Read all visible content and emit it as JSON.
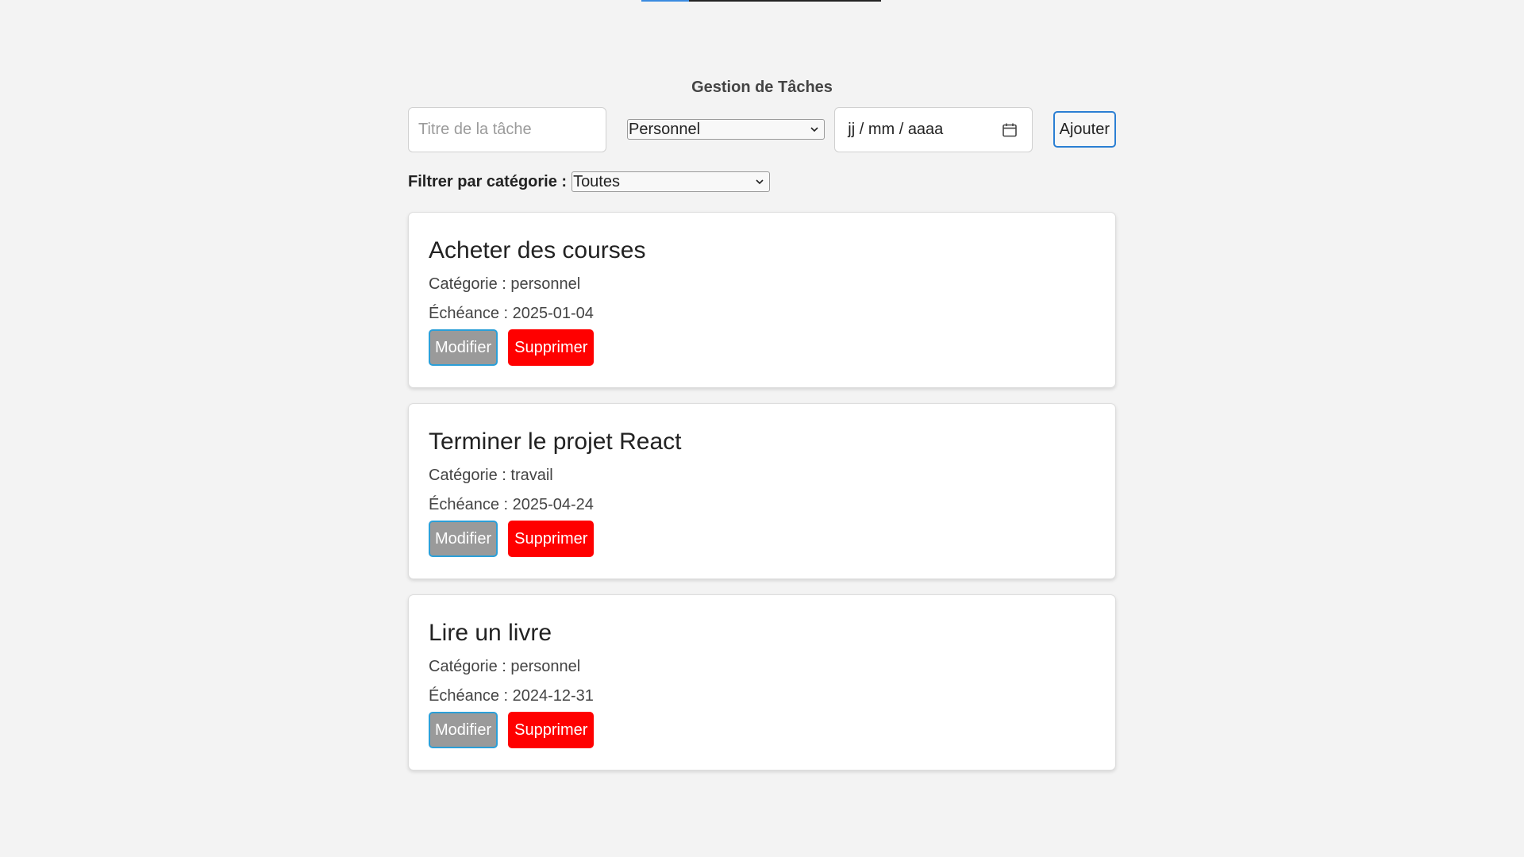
{
  "app": {
    "title": "Gestion de Tâches"
  },
  "form": {
    "title_placeholder": "Titre de la tâche",
    "title_value": "",
    "category_selected": "Personnel",
    "date_placeholder": "jj / mm / aaaa",
    "add_label": "Ajouter"
  },
  "filter": {
    "label": "Filtrer par catégorie :",
    "selected": "Toutes"
  },
  "tasks": [
    {
      "title": "Acheter des courses",
      "category_line": "Catégorie : personnel",
      "due_line": "Échéance : 2025-01-04",
      "edit_label": "Modifier",
      "delete_label": "Supprimer"
    },
    {
      "title": "Terminer le projet React",
      "category_line": "Catégorie : travail",
      "due_line": "Échéance : 2025-04-24",
      "edit_label": "Modifier",
      "delete_label": "Supprimer"
    },
    {
      "title": "Lire un livre",
      "category_line": "Catégorie : personnel",
      "due_line": "Échéance : 2024-12-31",
      "edit_label": "Modifier",
      "delete_label": "Supprimer"
    }
  ],
  "icons": {
    "select_arrow": "chevron-down-icon",
    "date_picker": "calendar-icon"
  },
  "colors": {
    "background": "#f3f3f3",
    "focus_border": "#2b7fd3",
    "delete": "#ff0000",
    "edit": "#9a9a9a"
  }
}
